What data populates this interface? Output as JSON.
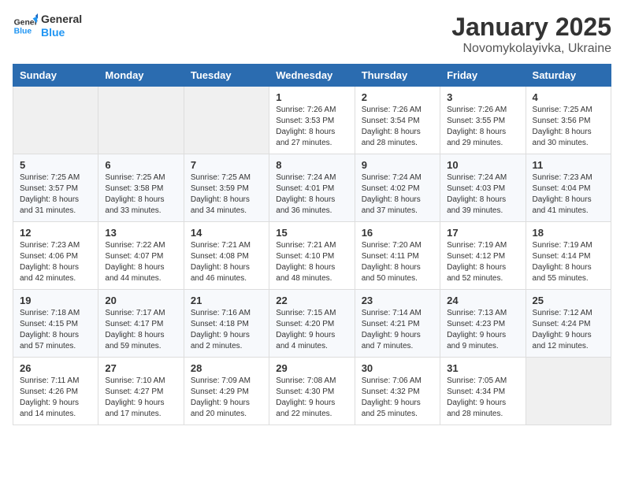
{
  "header": {
    "logo_line1": "General",
    "logo_line2": "Blue",
    "title": "January 2025",
    "subtitle": "Novomykolayivka, Ukraine"
  },
  "weekdays": [
    "Sunday",
    "Monday",
    "Tuesday",
    "Wednesday",
    "Thursday",
    "Friday",
    "Saturday"
  ],
  "weeks": [
    [
      {
        "day": "",
        "info": ""
      },
      {
        "day": "",
        "info": ""
      },
      {
        "day": "",
        "info": ""
      },
      {
        "day": "1",
        "info": "Sunrise: 7:26 AM\nSunset: 3:53 PM\nDaylight: 8 hours and 27 minutes."
      },
      {
        "day": "2",
        "info": "Sunrise: 7:26 AM\nSunset: 3:54 PM\nDaylight: 8 hours and 28 minutes."
      },
      {
        "day": "3",
        "info": "Sunrise: 7:26 AM\nSunset: 3:55 PM\nDaylight: 8 hours and 29 minutes."
      },
      {
        "day": "4",
        "info": "Sunrise: 7:25 AM\nSunset: 3:56 PM\nDaylight: 8 hours and 30 minutes."
      }
    ],
    [
      {
        "day": "5",
        "info": "Sunrise: 7:25 AM\nSunset: 3:57 PM\nDaylight: 8 hours and 31 minutes."
      },
      {
        "day": "6",
        "info": "Sunrise: 7:25 AM\nSunset: 3:58 PM\nDaylight: 8 hours and 33 minutes."
      },
      {
        "day": "7",
        "info": "Sunrise: 7:25 AM\nSunset: 3:59 PM\nDaylight: 8 hours and 34 minutes."
      },
      {
        "day": "8",
        "info": "Sunrise: 7:24 AM\nSunset: 4:01 PM\nDaylight: 8 hours and 36 minutes."
      },
      {
        "day": "9",
        "info": "Sunrise: 7:24 AM\nSunset: 4:02 PM\nDaylight: 8 hours and 37 minutes."
      },
      {
        "day": "10",
        "info": "Sunrise: 7:24 AM\nSunset: 4:03 PM\nDaylight: 8 hours and 39 minutes."
      },
      {
        "day": "11",
        "info": "Sunrise: 7:23 AM\nSunset: 4:04 PM\nDaylight: 8 hours and 41 minutes."
      }
    ],
    [
      {
        "day": "12",
        "info": "Sunrise: 7:23 AM\nSunset: 4:06 PM\nDaylight: 8 hours and 42 minutes."
      },
      {
        "day": "13",
        "info": "Sunrise: 7:22 AM\nSunset: 4:07 PM\nDaylight: 8 hours and 44 minutes."
      },
      {
        "day": "14",
        "info": "Sunrise: 7:21 AM\nSunset: 4:08 PM\nDaylight: 8 hours and 46 minutes."
      },
      {
        "day": "15",
        "info": "Sunrise: 7:21 AM\nSunset: 4:10 PM\nDaylight: 8 hours and 48 minutes."
      },
      {
        "day": "16",
        "info": "Sunrise: 7:20 AM\nSunset: 4:11 PM\nDaylight: 8 hours and 50 minutes."
      },
      {
        "day": "17",
        "info": "Sunrise: 7:19 AM\nSunset: 4:12 PM\nDaylight: 8 hours and 52 minutes."
      },
      {
        "day": "18",
        "info": "Sunrise: 7:19 AM\nSunset: 4:14 PM\nDaylight: 8 hours and 55 minutes."
      }
    ],
    [
      {
        "day": "19",
        "info": "Sunrise: 7:18 AM\nSunset: 4:15 PM\nDaylight: 8 hours and 57 minutes."
      },
      {
        "day": "20",
        "info": "Sunrise: 7:17 AM\nSunset: 4:17 PM\nDaylight: 8 hours and 59 minutes."
      },
      {
        "day": "21",
        "info": "Sunrise: 7:16 AM\nSunset: 4:18 PM\nDaylight: 9 hours and 2 minutes."
      },
      {
        "day": "22",
        "info": "Sunrise: 7:15 AM\nSunset: 4:20 PM\nDaylight: 9 hours and 4 minutes."
      },
      {
        "day": "23",
        "info": "Sunrise: 7:14 AM\nSunset: 4:21 PM\nDaylight: 9 hours and 7 minutes."
      },
      {
        "day": "24",
        "info": "Sunrise: 7:13 AM\nSunset: 4:23 PM\nDaylight: 9 hours and 9 minutes."
      },
      {
        "day": "25",
        "info": "Sunrise: 7:12 AM\nSunset: 4:24 PM\nDaylight: 9 hours and 12 minutes."
      }
    ],
    [
      {
        "day": "26",
        "info": "Sunrise: 7:11 AM\nSunset: 4:26 PM\nDaylight: 9 hours and 14 minutes."
      },
      {
        "day": "27",
        "info": "Sunrise: 7:10 AM\nSunset: 4:27 PM\nDaylight: 9 hours and 17 minutes."
      },
      {
        "day": "28",
        "info": "Sunrise: 7:09 AM\nSunset: 4:29 PM\nDaylight: 9 hours and 20 minutes."
      },
      {
        "day": "29",
        "info": "Sunrise: 7:08 AM\nSunset: 4:30 PM\nDaylight: 9 hours and 22 minutes."
      },
      {
        "day": "30",
        "info": "Sunrise: 7:06 AM\nSunset: 4:32 PM\nDaylight: 9 hours and 25 minutes."
      },
      {
        "day": "31",
        "info": "Sunrise: 7:05 AM\nSunset: 4:34 PM\nDaylight: 9 hours and 28 minutes."
      },
      {
        "day": "",
        "info": ""
      }
    ]
  ]
}
